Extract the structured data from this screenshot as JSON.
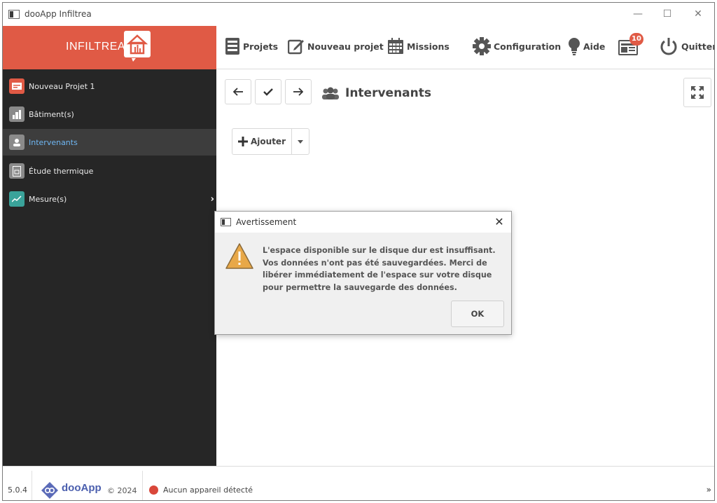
{
  "window": {
    "title": "dooApp Infiltrea",
    "minimize_glyph": "—",
    "maximize_glyph": "☐",
    "close_glyph": "✕"
  },
  "brand": {
    "name": "INFILTREA",
    "color": "#e05a45"
  },
  "toolbar": {
    "items": [
      {
        "label": "Projets",
        "icon": "projects-icon"
      },
      {
        "label": "Nouveau projet",
        "icon": "edit-icon"
      },
      {
        "label": "Missions",
        "icon": "calendar-icon"
      },
      {
        "label": "Configuration",
        "icon": "gear-icon"
      },
      {
        "label": "Aide",
        "icon": "lightbulb-icon"
      },
      {
        "label": "",
        "icon": "news-icon",
        "badge": "10"
      },
      {
        "label": "Quitter",
        "icon": "power-icon"
      }
    ]
  },
  "sidebar": {
    "items": [
      {
        "label": "Nouveau Projet 1",
        "icon": "project-icon",
        "icon_color": "#e05a45"
      },
      {
        "label": "Bâtiment(s)",
        "icon": "building-icon",
        "icon_color": "#8a8a8a"
      },
      {
        "label": "Intervenants",
        "icon": "people-icon",
        "icon_color": "#8a8a8a",
        "active": true
      },
      {
        "label": "Étude thermique",
        "icon": "document-icon",
        "icon_color": "#8a8a8a"
      },
      {
        "label": "Mesure(s)",
        "icon": "chart-icon",
        "icon_color": "#3aa39a"
      }
    ],
    "chevron": "›"
  },
  "main": {
    "section_title": "Intervenants",
    "add_label": "Ajouter"
  },
  "footer": {
    "version": "5.0.4",
    "brand": "dooApp",
    "copyright": "© 2024",
    "status": "Aucun appareil détecté",
    "expand": "»"
  },
  "dialog": {
    "title": "Avertissement",
    "close_glyph": "✕",
    "message": "L'espace disponible sur le disque dur est insuffisant. Vos données n'ont pas été sauvegardées. Merci de libérer immédiatement de l'espace sur votre disque pour permettre la sauvegarde des données.",
    "ok_label": "OK"
  }
}
